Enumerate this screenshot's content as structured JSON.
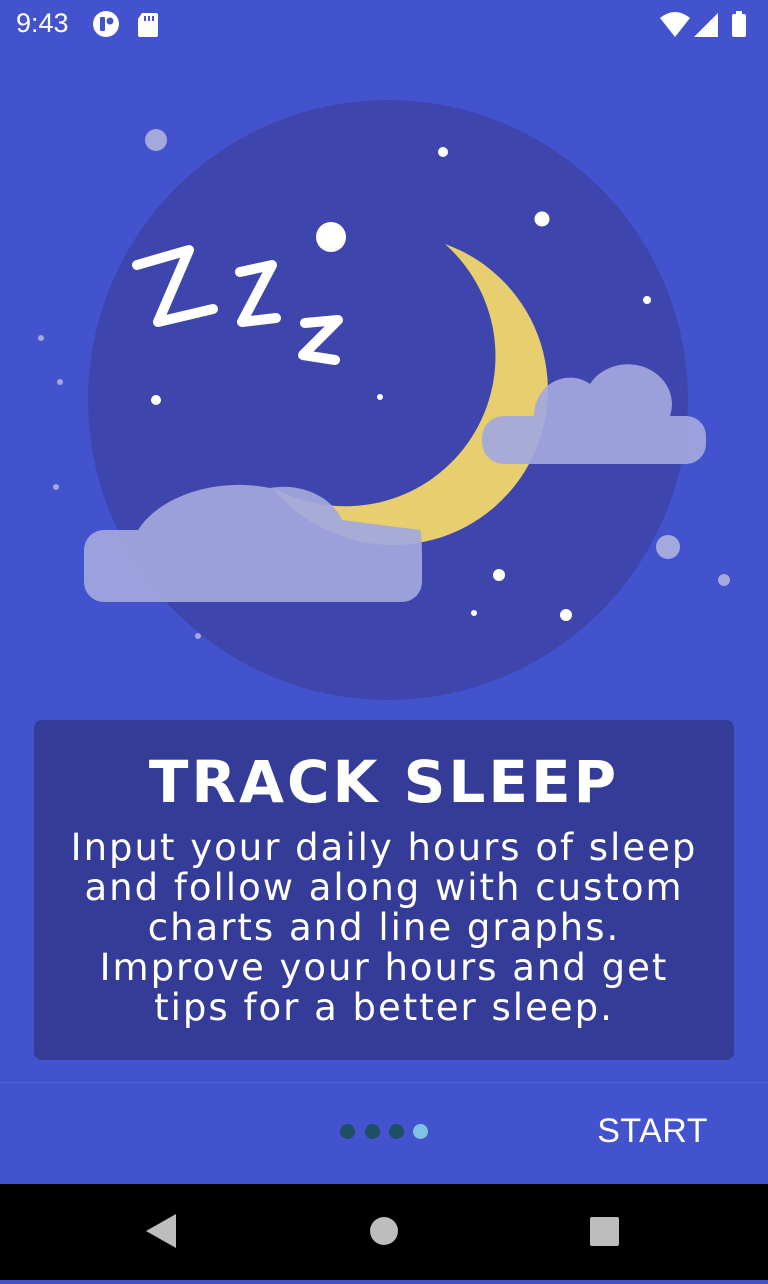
{
  "status_bar": {
    "time": "9:43",
    "left_icons": [
      "cast-icon",
      "sd-card-icon"
    ],
    "right_icons": [
      "wifi-icon",
      "cell-signal-icon",
      "battery-icon"
    ]
  },
  "onboarding": {
    "illustration": "sleeping-moon-illustration",
    "title": "TRACK SLEEP",
    "body": "Input your daily hours of sleep\nand follow along with custom\ncharts and line graphs.\nImprove your hours and get\ntips for a better sleep.",
    "page_indicator": {
      "total": 4,
      "current": 4
    },
    "start_label": "START"
  },
  "colors": {
    "background": "#4353CE",
    "card": "#343C97",
    "moon": "#E7CE6E",
    "cloud": "#A3A8DD",
    "dot_inactive": "#1C4F63",
    "dot_active": "#7FC3E4"
  },
  "nav_bar": {
    "icons": [
      "back-icon",
      "home-icon",
      "recents-icon"
    ]
  }
}
